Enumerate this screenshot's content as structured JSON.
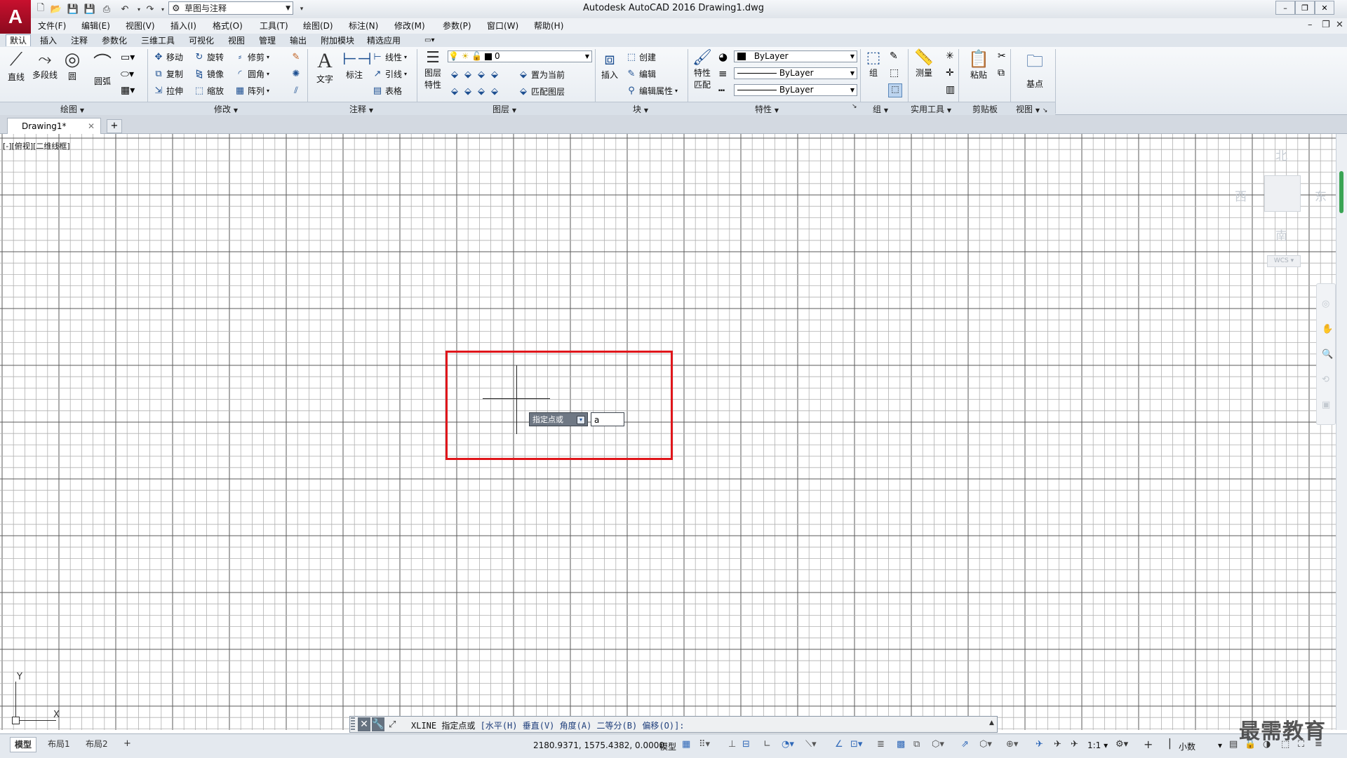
{
  "window": {
    "title": "Autodesk AutoCAD 2016    Drawing1.dwg",
    "app_logo": "A",
    "workspace": "草图与注释"
  },
  "menu": [
    "文件(F)",
    "编辑(E)",
    "视图(V)",
    "插入(I)",
    "格式(O)",
    "工具(T)",
    "绘图(D)",
    "标注(N)",
    "修改(M)",
    "参数(P)",
    "窗口(W)",
    "帮助(H)"
  ],
  "ribbon_tabs": [
    "默认",
    "插入",
    "注释",
    "参数化",
    "三维工具",
    "可视化",
    "视图",
    "管理",
    "输出",
    "附加模块",
    "精选应用"
  ],
  "ribbon": {
    "draw": {
      "line": "直线",
      "polyline": "多段线",
      "circle": "圆",
      "arc": "圆弧",
      "panel": "绘图"
    },
    "modify": {
      "move": "移动",
      "rotate": "旋转",
      "trim": "修剪",
      "copy": "复制",
      "mirror": "镜像",
      "fillet": "圆角",
      "stretch": "拉伸",
      "scale": "缩放",
      "array": "阵列",
      "panel": "修改"
    },
    "annotation": {
      "text": "文字",
      "dimension": "标注",
      "linear": "线性",
      "leader": "引线",
      "table": "表格",
      "panel": "注释"
    },
    "layers": {
      "layer_props": "图层",
      "layer_props2": "特性",
      "current_layer": "0",
      "set_current": "置为当前",
      "match_layer": "匹配图层",
      "panel": "图层"
    },
    "block": {
      "insert": "插入",
      "create": "创建",
      "edit": "编辑",
      "edit_attr": "编辑属性",
      "panel": "块"
    },
    "properties": {
      "match": "特性",
      "match2": "匹配",
      "color": "ByLayer",
      "linetype": "ByLayer",
      "lineweight": "ByLayer",
      "panel": "特性"
    },
    "groups": {
      "group": "组",
      "panel": "组"
    },
    "utilities": {
      "measure": "测量",
      "panel": "实用工具"
    },
    "clipboard": {
      "paste": "粘贴",
      "panel": "剪贴板"
    },
    "view": {
      "base": "基点",
      "panel": "视图"
    }
  },
  "file_tab": "Drawing1*",
  "viewport_label": "[-][俯视][二维线框]",
  "viewcube": {
    "north": "北",
    "south": "南",
    "east": "东",
    "west": "西",
    "wcs": "WCS"
  },
  "tooltip": {
    "prompt": "指定点或",
    "input_value": "a"
  },
  "ucs": {
    "y": "Y",
    "x": "X"
  },
  "command_line": {
    "command": "XLINE 指定点或",
    "options": "[水平(H) 垂直(V) 角度(A) 二等分(B) 偏移(O)]:"
  },
  "layout_tabs": [
    "模型",
    "布局1",
    "布局2"
  ],
  "status": {
    "coords": "2180.9371, 1575.4382, 0.0000",
    "space": "模型",
    "scale": "1:1",
    "units": "小数"
  },
  "watermark": "最需教育",
  "colors": {
    "highlight_box": "#e0161b",
    "grid_major": "#5a5a5a",
    "grid_minor": "#b0b0b0",
    "logo_red": "#c8102e"
  }
}
